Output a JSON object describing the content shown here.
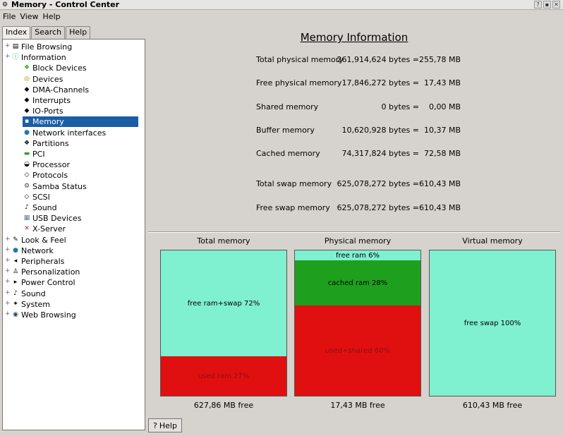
{
  "window": {
    "title": "Memory - Control Center",
    "app_icon": "control-center-icon"
  },
  "menu": [
    "File",
    "View",
    "Help"
  ],
  "tabs": [
    "Index",
    "Search",
    "Help"
  ],
  "tree": [
    {
      "label": "File Browsing",
      "icon": "folder-icon",
      "level": 0
    },
    {
      "label": "Information",
      "icon": "info-icon",
      "level": 0
    },
    {
      "label": "Block Devices",
      "icon": "block-devices-icon",
      "level": 1
    },
    {
      "label": "Devices",
      "icon": "devices-icon",
      "level": 1
    },
    {
      "label": "DMA-Channels",
      "icon": "dma-icon",
      "level": 1
    },
    {
      "label": "Interrupts",
      "icon": "interrupts-icon",
      "level": 1
    },
    {
      "label": "IO-Ports",
      "icon": "io-ports-icon",
      "level": 1
    },
    {
      "label": "Memory",
      "icon": "memory-icon",
      "level": 1,
      "selected": true
    },
    {
      "label": "Network interfaces",
      "icon": "network-interfaces-icon",
      "level": 1
    },
    {
      "label": "Partitions",
      "icon": "partitions-icon",
      "level": 1
    },
    {
      "label": "PCI",
      "icon": "pci-icon",
      "level": 1
    },
    {
      "label": "Processor",
      "icon": "processor-icon",
      "level": 1
    },
    {
      "label": "Protocols",
      "icon": "protocols-icon",
      "level": 1
    },
    {
      "label": "Samba Status",
      "icon": "samba-icon",
      "level": 1
    },
    {
      "label": "SCSI",
      "icon": "scsi-icon",
      "level": 1
    },
    {
      "label": "Sound",
      "icon": "sound-icon",
      "level": 1
    },
    {
      "label": "USB Devices",
      "icon": "usb-icon",
      "level": 1
    },
    {
      "label": "X-Server",
      "icon": "x-server-icon",
      "level": 1
    },
    {
      "label": "Look & Feel",
      "icon": "look-feel-icon",
      "level": 0
    },
    {
      "label": "Network",
      "icon": "network-icon",
      "level": 0
    },
    {
      "label": "Peripherals",
      "icon": "peripherals-icon",
      "level": 0
    },
    {
      "label": "Personalization",
      "icon": "personalization-icon",
      "level": 0
    },
    {
      "label": "Power Control",
      "icon": "power-icon",
      "level": 0
    },
    {
      "label": "Sound",
      "icon": "sound-icon",
      "level": 0
    },
    {
      "label": "System",
      "icon": "system-icon",
      "level": 0
    },
    {
      "label": "Web Browsing",
      "icon": "web-icon",
      "level": 0
    }
  ],
  "memory_info": {
    "title": "Memory Information",
    "rows": [
      {
        "label": "Total physical memory",
        "bytes": "261,914,624 bytes =",
        "mb": "255,78 MB"
      },
      {
        "label": "Free physical memory",
        "bytes": "17,846,272 bytes =",
        "mb": "17,43 MB"
      },
      {
        "label": "Shared memory",
        "bytes": "0 bytes =",
        "mb": "0,00 MB"
      },
      {
        "label": "Buffer memory",
        "bytes": "10,620,928 bytes =",
        "mb": "10,37 MB"
      },
      {
        "label": "Cached memory",
        "bytes": "74,317,824 bytes =",
        "mb": "72,58 MB"
      },
      {
        "label": "Total swap memory",
        "bytes": "625,078,272 bytes =",
        "mb": "610,43 MB"
      },
      {
        "label": "Free swap memory",
        "bytes": "625,078,272 bytes =",
        "mb": "610,43 MB"
      }
    ]
  },
  "graphs": [
    {
      "title": "Total memory",
      "free_label": "627,86 MB free",
      "segments": [
        {
          "label": "free ram+swap 72%",
          "fraction": 0.73,
          "color": "#7ff0d0"
        },
        {
          "label": "used ram 27%",
          "fraction": 0.27,
          "color": "#e01010"
        }
      ]
    },
    {
      "title": "Physical memory",
      "free_label": "17,43 MB free",
      "segments": [
        {
          "label": "free ram 6%",
          "fraction": 0.07,
          "color": "#7ff0d0"
        },
        {
          "label": "cached ram 28%",
          "fraction": 0.31,
          "color": "#1ea01e"
        },
        {
          "label": "used+shared 60%",
          "fraction": 0.62,
          "color": "#e01010"
        }
      ]
    },
    {
      "title": "Virtual memory",
      "free_label": "610,43 MB free",
      "segments": [
        {
          "label": "free swap 100%",
          "fraction": 1.0,
          "color": "#7ff0d0"
        }
      ]
    }
  ],
  "footer": {
    "help_label": "Help"
  }
}
